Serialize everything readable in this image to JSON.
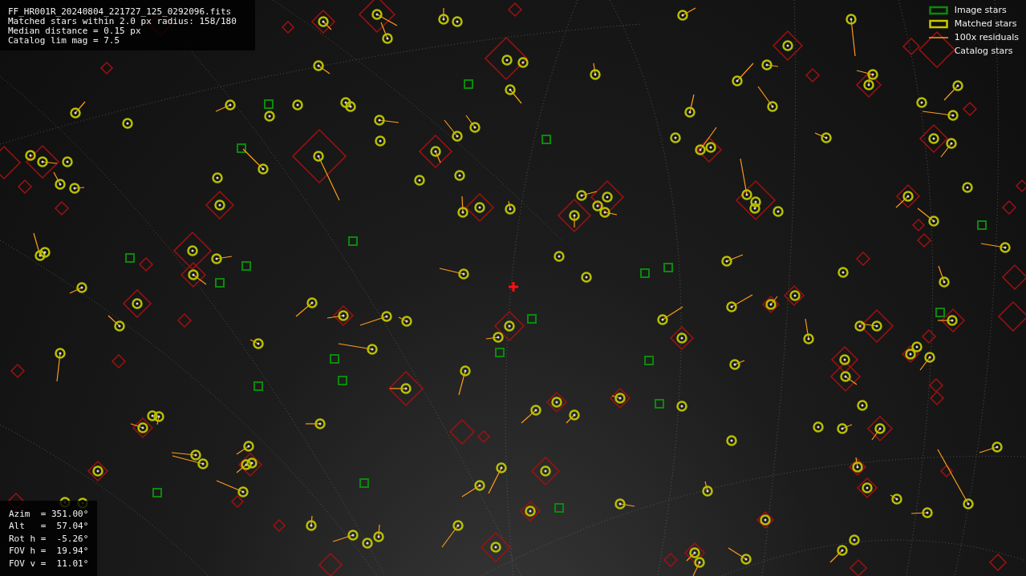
{
  "info": {
    "lines": [
      "FF_HR001R_20240804_221727_125_0292096.fits",
      "Matched stars within 2.0 px radius: 158/180",
      "Median distance = 0.15 px",
      "Catalog lim mag = 7.5"
    ]
  },
  "legend": [
    {
      "kind": "image",
      "label": "Image stars"
    },
    {
      "kind": "matched",
      "label": "Matched stars"
    },
    {
      "kind": "residual",
      "label": "100x residuals"
    },
    {
      "kind": "catalog",
      "label": "Catalog stars"
    }
  ],
  "pointing": {
    "lines": [
      "Azim  = 351.00°",
      "Alt   =  57.04°",
      "Rot h =  -5.26°",
      "FOV h =  19.94°",
      "FOV v =  11.01°"
    ]
  }
}
